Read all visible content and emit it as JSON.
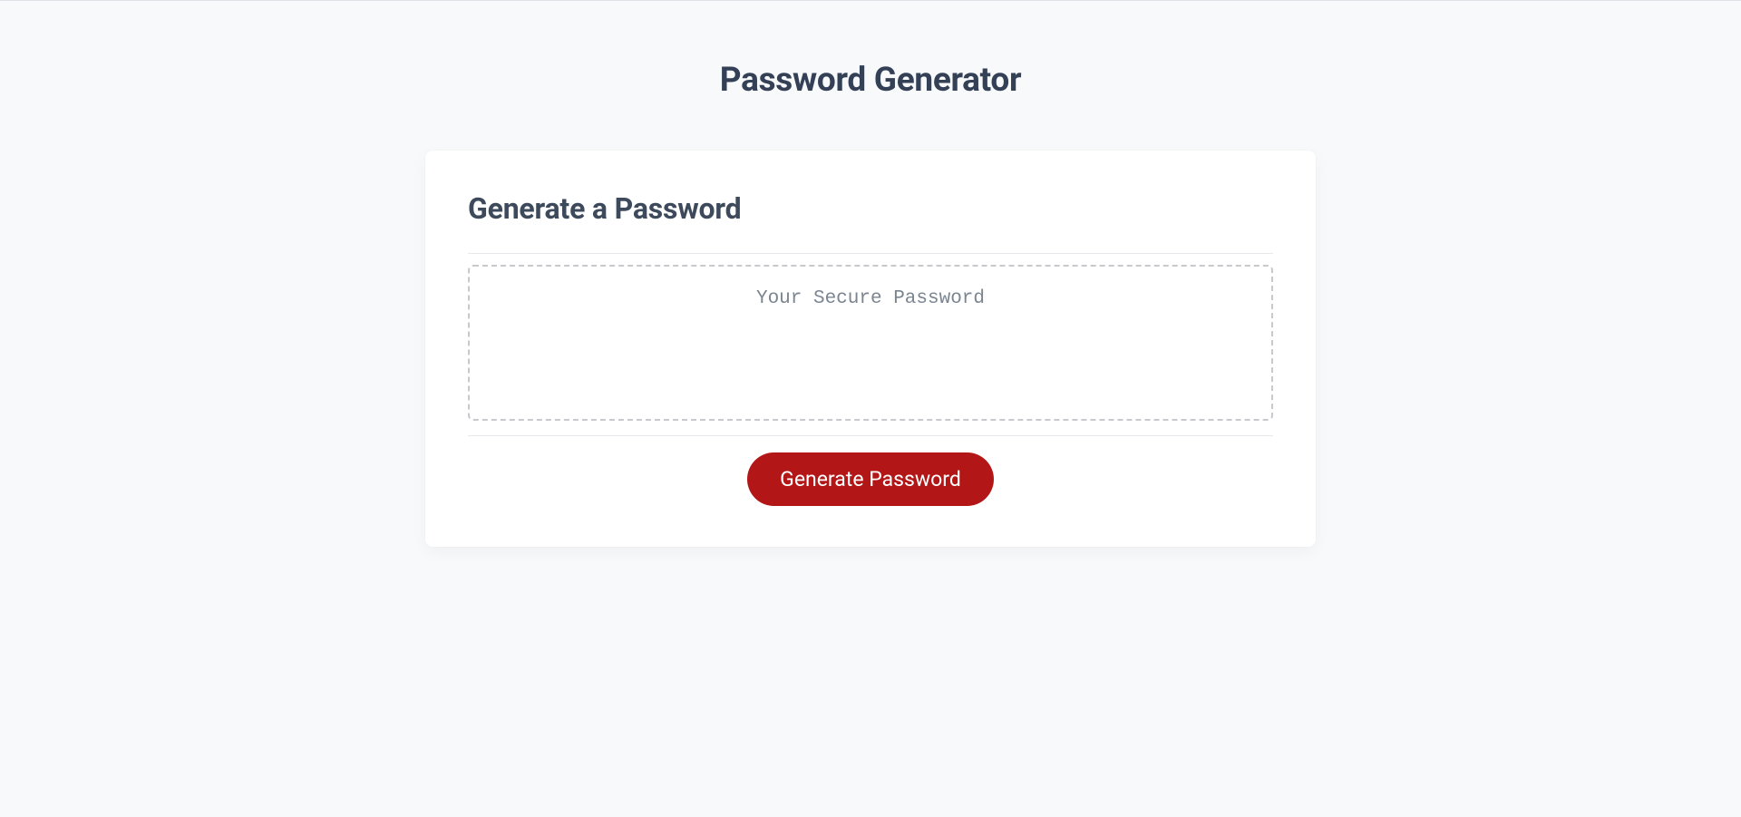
{
  "page": {
    "title": "Password Generator"
  },
  "card": {
    "heading": "Generate a Password",
    "output_placeholder": "Your Secure Password",
    "output_value": "",
    "generate_button_label": "Generate Password"
  },
  "colors": {
    "background": "#f8f9fb",
    "card_bg": "#ffffff",
    "heading_text": "#3d4a5c",
    "button_bg": "#b31616",
    "button_text": "#ffffff",
    "dashed_border": "#c8c9cd"
  }
}
